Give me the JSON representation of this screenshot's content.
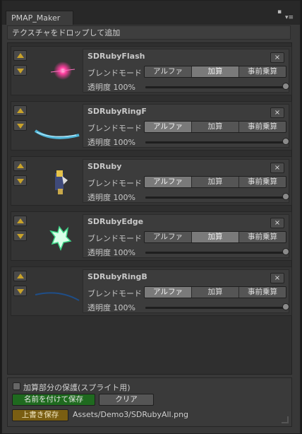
{
  "window": {
    "tab_title": "PMAP_Maker"
  },
  "drop_hint": "テクスチャをドロップして追加",
  "blend_label": "ブレンドモード",
  "blend_options": [
    "アルファ",
    "加算",
    "事前乗算"
  ],
  "items": [
    {
      "name": "SDRubyFlash",
      "blend_selected": "加算",
      "opacity_label": "透明度 100%",
      "opacity": 1.0
    },
    {
      "name": "SDRubyRingF",
      "blend_selected": "アルファ",
      "opacity_label": "透明度 100%",
      "opacity": 1.0
    },
    {
      "name": "SDRuby",
      "blend_selected": "アルファ",
      "opacity_label": "透明度 100%",
      "opacity": 1.0
    },
    {
      "name": "SDRubyEdge",
      "blend_selected": "加算",
      "opacity_label": "透明度 100%",
      "opacity": 1.0
    },
    {
      "name": "SDRubyRingB",
      "blend_selected": "アルファ",
      "opacity_label": "透明度 100%",
      "opacity": 1.0
    }
  ],
  "close_glyph": "×",
  "footer": {
    "protect_label": "加算部分の保護(スプライト用)",
    "protect_checked": false,
    "save_as_label": "名前を付けて保存",
    "clear_label": "クリア",
    "overwrite_label": "上書き保存",
    "path": "Assets/Demo3/SDRubyAll.png"
  },
  "colors": {
    "accent_green": "#1f6a1f",
    "accent_gold": "#7a5e12",
    "arrow": "#c8a22a",
    "selected_segment": "#7a7a7a"
  },
  "icons": [
    "lock-icon",
    "menu-icon",
    "arrow-up-icon",
    "arrow-down-icon",
    "close-icon"
  ]
}
